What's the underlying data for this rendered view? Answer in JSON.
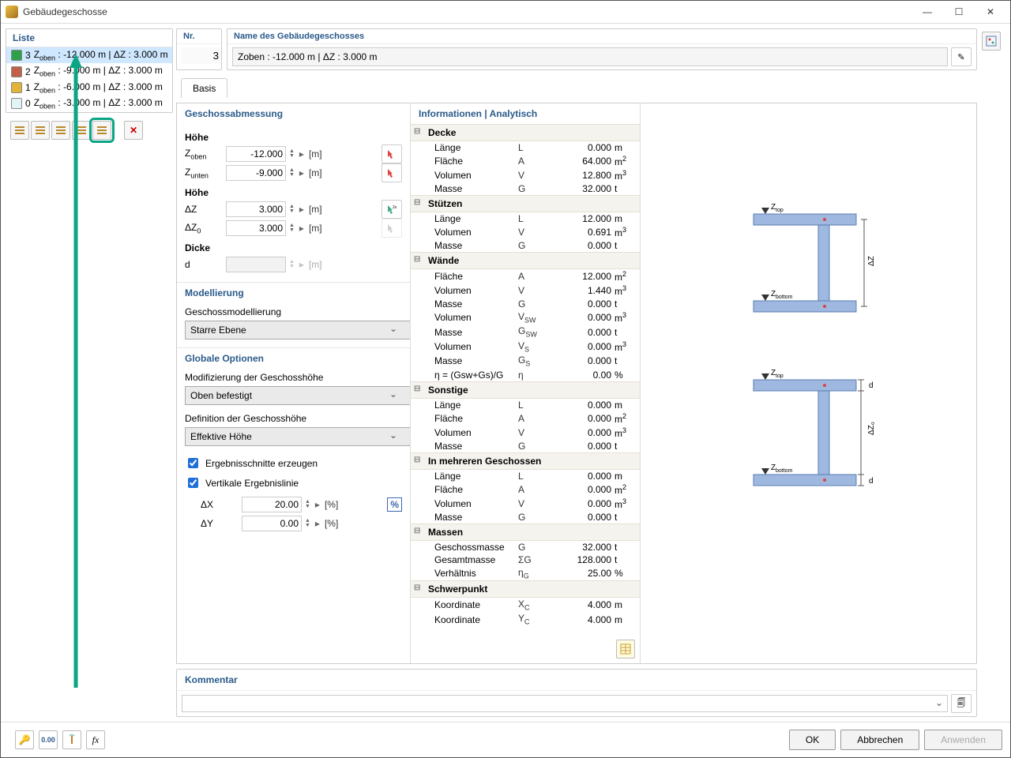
{
  "window": {
    "title": "Gebäudegeschosse"
  },
  "sidebar": {
    "title": "Liste",
    "items": [
      {
        "idx": "3",
        "label": " : -12.000 m | ΔZ : 3.000 m",
        "color": "#2fa04a",
        "selected": true
      },
      {
        "idx": "2",
        "label": " : -9.000 m | ΔZ : 3.000 m",
        "color": "#c0604a"
      },
      {
        "idx": "1",
        "label": " : -6.000 m | ΔZ : 3.000 m",
        "color": "#e2b23a"
      },
      {
        "idx": "0",
        "label": " : -3.000 m | ΔZ : 3.000 m",
        "color": "#e3f4f6"
      }
    ]
  },
  "header": {
    "nr_label": "Nr.",
    "nr_value": "3",
    "name_label": "Name des Gebäudegeschosses",
    "name_value": "Zoben : -12.000 m | ΔZ : 3.000 m"
  },
  "tabs": {
    "basis": "Basis"
  },
  "dims": {
    "title": "Geschossabmessung",
    "hohe": "Höhe",
    "z_oben": "-12.000",
    "z_unten": "-9.000",
    "dz": "3.000",
    "dz0": "3.000",
    "dicke": "Dicke",
    "d": "",
    "unit_m": "[m]"
  },
  "labels": {
    "z_oben": "Z",
    "z_oben_sub": "oben",
    "z_unten": "Z",
    "z_unten_sub": "unten",
    "dz": "ΔZ",
    "dz0": "ΔZ",
    "dz0_sub": "0",
    "d": "d",
    "dx": "ΔX",
    "dy": "ΔY"
  },
  "model": {
    "title": "Modellierung",
    "sub": "Geschossmodellierung",
    "value": "Starre Ebene"
  },
  "global": {
    "title": "Globale Optionen",
    "mod_label": "Modifizierung der Geschosshöhe",
    "mod_value": "Oben befestigt",
    "def_label": "Definition der Geschosshöhe",
    "def_value": "Effektive Höhe",
    "chk1": "Ergebnisschnitte erzeugen",
    "chk2": "Vertikale Ergebnislinie",
    "dx": "20.00",
    "dy": "0.00",
    "pct": "[%]",
    "pct_btn": "%"
  },
  "info": {
    "title": "Informationen | Analytisch",
    "groups": [
      {
        "name": "Decke",
        "rows": [
          {
            "n": "Länge",
            "s": "L",
            "v": "0.000",
            "u": "m"
          },
          {
            "n": "Fläche",
            "s": "A",
            "v": "64.000",
            "u": "m",
            "sup": "2"
          },
          {
            "n": "Volumen",
            "s": "V",
            "v": "12.800",
            "u": "m",
            "sup": "3"
          },
          {
            "n": "Masse",
            "s": "G",
            "v": "32.000",
            "u": "t"
          }
        ]
      },
      {
        "name": "Stützen",
        "rows": [
          {
            "n": "Länge",
            "s": "L",
            "v": "12.000",
            "u": "m"
          },
          {
            "n": "Volumen",
            "s": "V",
            "v": "0.691",
            "u": "m",
            "sup": "3"
          },
          {
            "n": "Masse",
            "s": "G",
            "v": "0.000",
            "u": "t"
          }
        ]
      },
      {
        "name": "Wände",
        "rows": [
          {
            "n": "Fläche",
            "s": "A",
            "v": "12.000",
            "u": "m",
            "sup": "2"
          },
          {
            "n": "Volumen",
            "s": "V",
            "v": "1.440",
            "u": "m",
            "sup": "3"
          },
          {
            "n": "Masse",
            "s": "G",
            "v": "0.000",
            "u": "t"
          },
          {
            "n": "Volumen",
            "s": "V",
            "sub": "SW",
            "v": "0.000",
            "u": "m",
            "sup": "3"
          },
          {
            "n": "Masse",
            "s": "G",
            "sub": "SW",
            "v": "0.000",
            "u": "t"
          },
          {
            "n": "Volumen",
            "s": "V",
            "sub": "S",
            "v": "0.000",
            "u": "m",
            "sup": "3"
          },
          {
            "n": "Masse",
            "s": "G",
            "sub": "S",
            "v": "0.000",
            "u": "t"
          },
          {
            "n": "η = (Gsw+Gs)/G",
            "s": "η",
            "v": "0.00",
            "u": "%"
          }
        ]
      },
      {
        "name": "Sonstige",
        "rows": [
          {
            "n": "Länge",
            "s": "L",
            "v": "0.000",
            "u": "m"
          },
          {
            "n": "Fläche",
            "s": "A",
            "v": "0.000",
            "u": "m",
            "sup": "2"
          },
          {
            "n": "Volumen",
            "s": "V",
            "v": "0.000",
            "u": "m",
            "sup": "3"
          },
          {
            "n": "Masse",
            "s": "G",
            "v": "0.000",
            "u": "t"
          }
        ]
      },
      {
        "name": "In mehreren Geschossen",
        "rows": [
          {
            "n": "Länge",
            "s": "L",
            "v": "0.000",
            "u": "m"
          },
          {
            "n": "Fläche",
            "s": "A",
            "v": "0.000",
            "u": "m",
            "sup": "2"
          },
          {
            "n": "Volumen",
            "s": "V",
            "v": "0.000",
            "u": "m",
            "sup": "3"
          },
          {
            "n": "Masse",
            "s": "G",
            "v": "0.000",
            "u": "t"
          }
        ]
      },
      {
        "name": "Massen",
        "rows": [
          {
            "n": "Geschossmasse",
            "s": "G",
            "v": "32.000",
            "u": "t"
          },
          {
            "n": "Gesamtmasse",
            "s": "ΣG",
            "v": "128.000",
            "u": "t"
          },
          {
            "n": "Verhältnis",
            "s": "η",
            "sub": "G",
            "v": "25.00",
            "u": "%"
          }
        ]
      },
      {
        "name": "Schwerpunkt",
        "rows": [
          {
            "n": "Koordinate",
            "s": "X",
            "sub": "C",
            "v": "4.000",
            "u": "m"
          },
          {
            "n": "Koordinate",
            "s": "Y",
            "sub": "C",
            "v": "4.000",
            "u": "m"
          }
        ]
      }
    ]
  },
  "diagram": {
    "z_top": "Z",
    "top_sub": "top",
    "z_bot": "Z",
    "bot_sub": "bottom",
    "dz": "ΔZ",
    "dz0": "ΔZ",
    "dz0_sub": "0",
    "d": "d"
  },
  "comment": {
    "title": "Kommentar"
  },
  "buttons": {
    "ok": "OK",
    "cancel": "Abbrechen",
    "apply": "Anwenden"
  }
}
